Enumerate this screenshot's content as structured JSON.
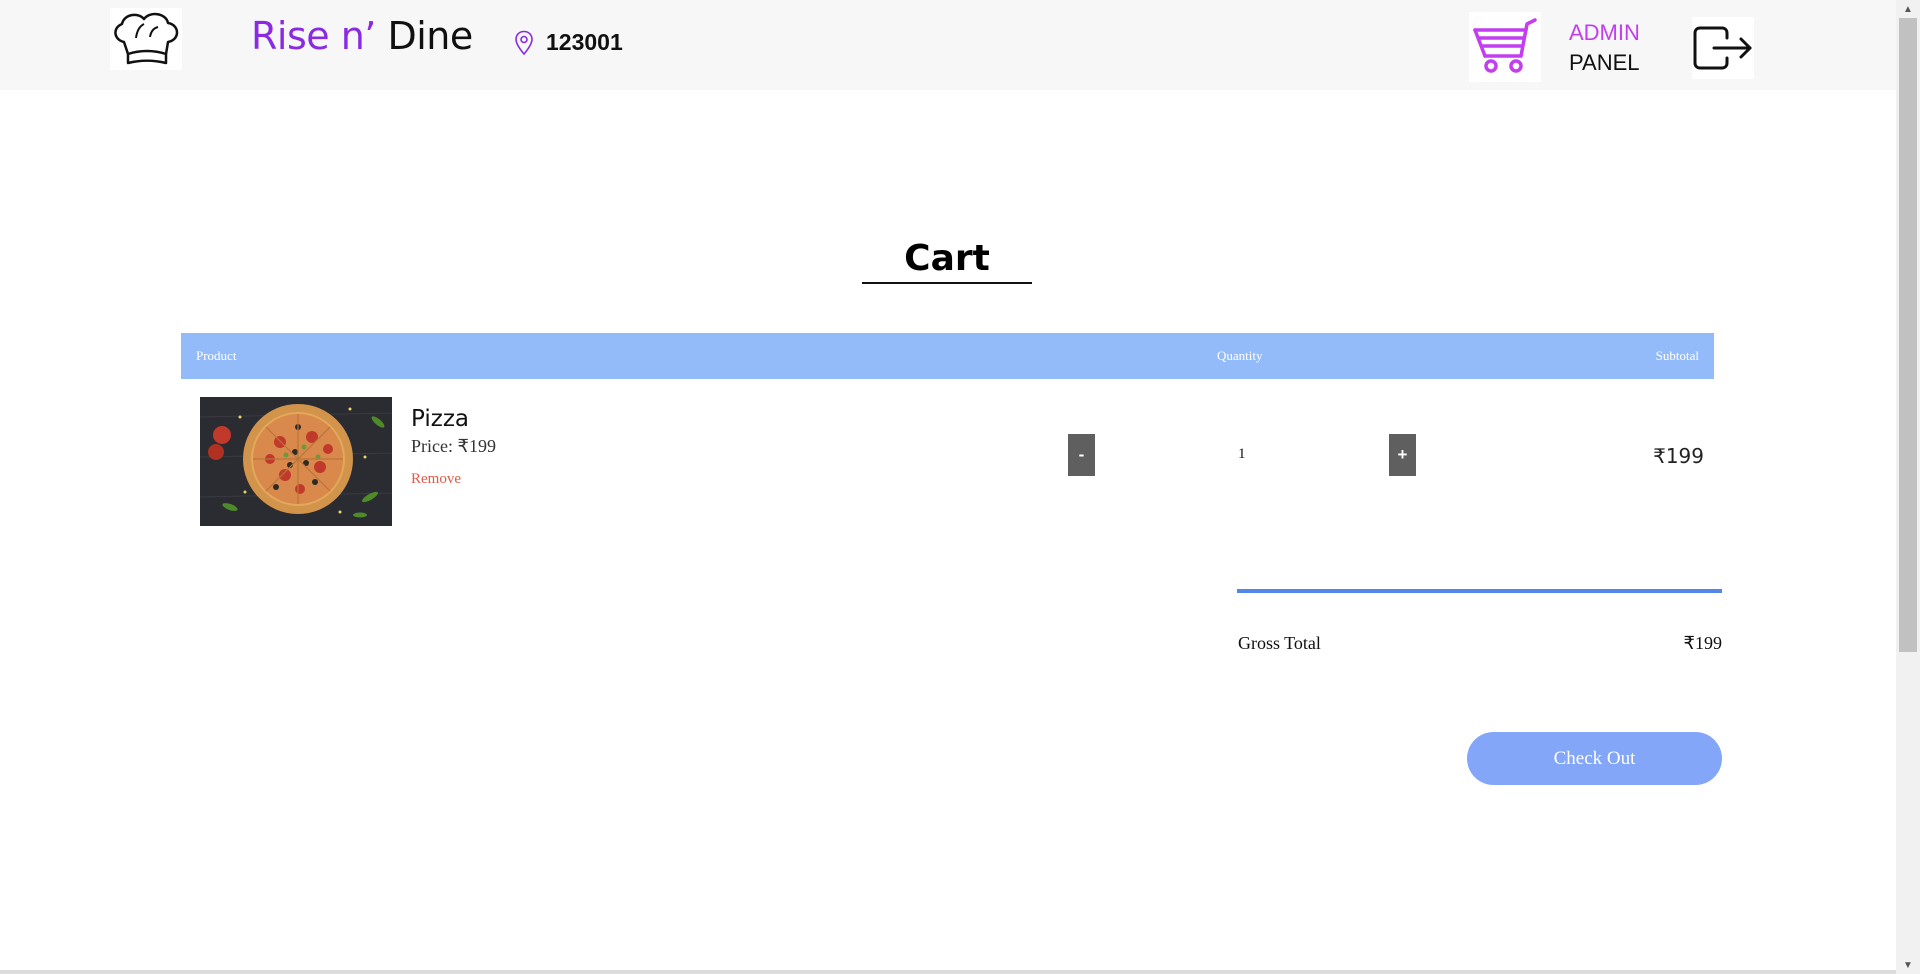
{
  "header": {
    "brand_accent": "Rise n’",
    "brand_rest": " Dine",
    "location_pin": "123001",
    "admin_line1": "ADMIN",
    "admin_line2": "PANEL",
    "icons": {
      "logo": "chef-hat-icon",
      "location": "map-pin-icon",
      "cart": "shopping-cart-icon",
      "logout": "logout-icon"
    }
  },
  "cart": {
    "title": "Cart",
    "columns": {
      "product": "Product",
      "quantity": "Quantity",
      "subtotal": "Subtotal"
    },
    "items": [
      {
        "name": "Pizza",
        "price": "Price: ₹199",
        "remove": "Remove",
        "minus": "-",
        "quantity": "1",
        "plus": "+",
        "subtotal": "₹199",
        "image": "pizza-photo"
      }
    ],
    "gross_total_label": "Gross Total",
    "gross_total_value": "₹199",
    "checkout_label": "Check Out"
  },
  "colors": {
    "brand_accent": "#8a2be2",
    "admin_accent": "#c23ef0",
    "table_header": "#93bbfa",
    "totals_rule": "#5486ea",
    "checkout_button": "#83a6f8",
    "remove_link": "#e05a47",
    "qty_button": "#5f5f5f"
  }
}
